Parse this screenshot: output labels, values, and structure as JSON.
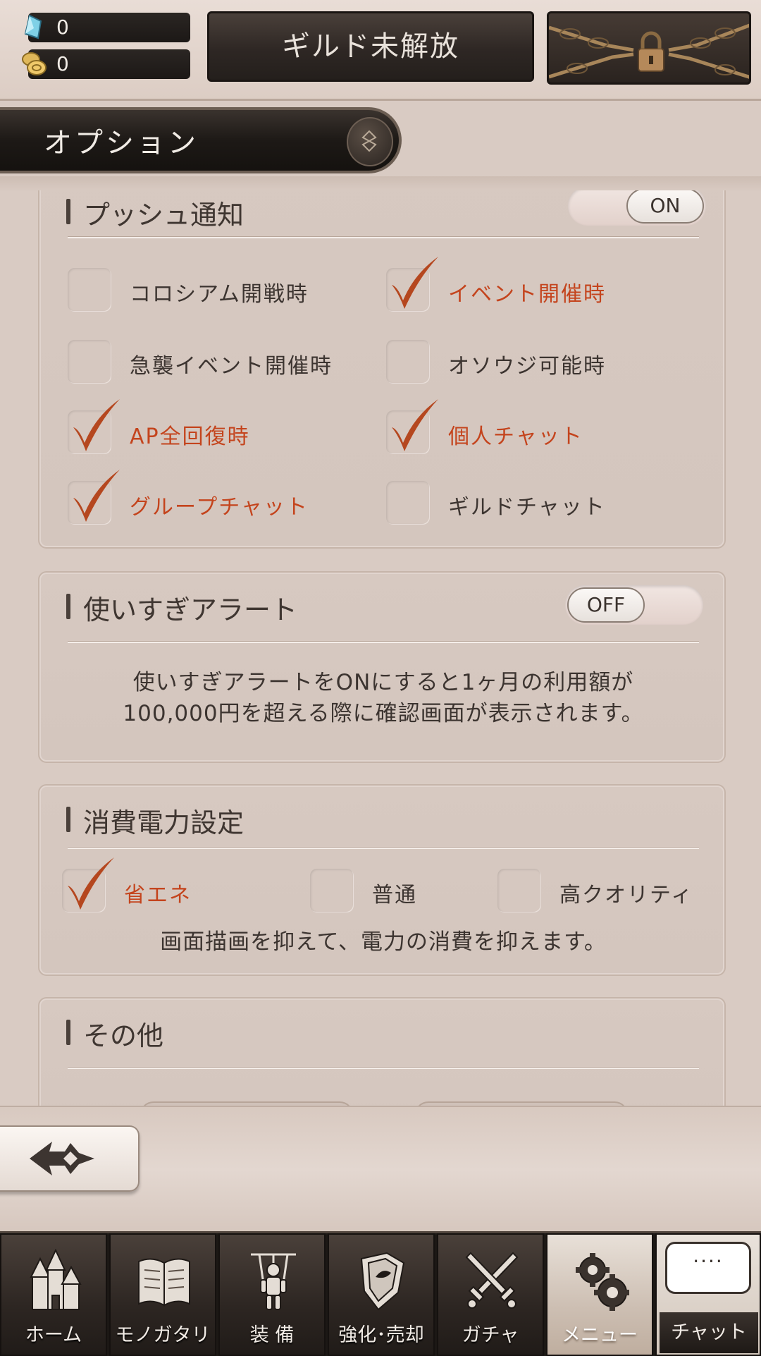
{
  "status": {
    "gems": "0",
    "coins": "0",
    "gem_icon": "crystal-icon",
    "coin_icon": "coin-icon"
  },
  "guild_button": "ギルド未解放",
  "lock_icon": "chain-lock-icon",
  "page_title": "オプション",
  "push": {
    "title": "プッシュ通知",
    "toggle": "ON",
    "options": [
      {
        "label": "コロシアム開戦時",
        "checked": false
      },
      {
        "label": "イベント開催時",
        "checked": true
      },
      {
        "label": "急襲イベント開催時",
        "checked": false
      },
      {
        "label": "オソウジ可能時",
        "checked": false
      },
      {
        "label": "AP全回復時",
        "checked": true
      },
      {
        "label": "個人チャット",
        "checked": true
      },
      {
        "label": "グループチャット",
        "checked": true
      },
      {
        "label": "ギルドチャット",
        "checked": false
      }
    ]
  },
  "alert": {
    "title": "使いすぎアラート",
    "toggle": "OFF",
    "note_line1": "使いすぎアラートをONにすると1ヶ月の利用額が",
    "note_line2": "100,000円を超える際に確認画面が表示されます。"
  },
  "power": {
    "title": "消費電力設定",
    "options": [
      {
        "label": "省エネ",
        "checked": true
      },
      {
        "label": "普通",
        "checked": false
      },
      {
        "label": "高クオリティ",
        "checked": false
      }
    ],
    "note": "画面描画を抑えて、電力の消費を抑えます。"
  },
  "other": {
    "title": "その他"
  },
  "nav": [
    {
      "label": "ホーム",
      "icon": "castle-icon"
    },
    {
      "label": "モノガタリ",
      "icon": "book-icon"
    },
    {
      "label": "装 備",
      "icon": "puppet-icon"
    },
    {
      "label": "強化･売却",
      "icon": "shield-icon"
    },
    {
      "label": "ガチャ",
      "icon": "crossed-swords-icon"
    },
    {
      "label": "メニュー",
      "icon": "gears-icon"
    }
  ],
  "chat": {
    "label": "チャット",
    "bubble": "····"
  },
  "colors": {
    "checked_text": "#c4441d",
    "check_mark": "#b5471f",
    "nav_bg": "#2d2622"
  }
}
